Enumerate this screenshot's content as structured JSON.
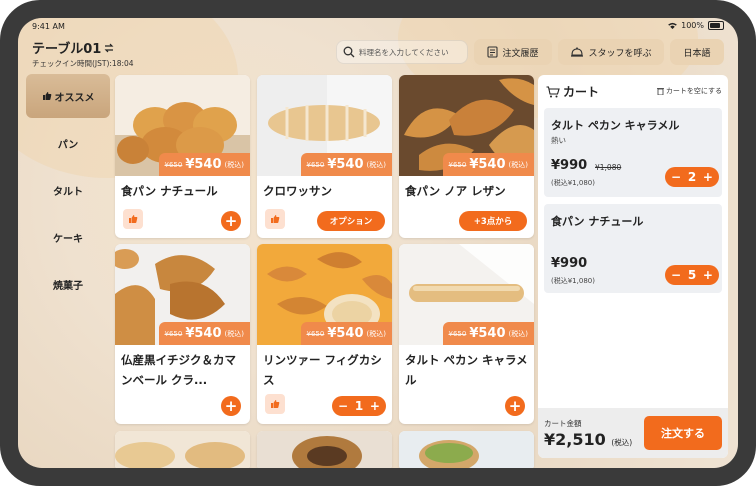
{
  "status": {
    "time": "9:41 AM",
    "battery": "100%"
  },
  "header": {
    "table_name": "テーブル01",
    "checkin": "チェックイン時間(JST):18:04",
    "search_placeholder": "料理名を入力してください",
    "order_history": "注文履歴",
    "call_staff": "スタッフを呼ぶ",
    "language": "日本語"
  },
  "sidebar": {
    "items": [
      {
        "label": "オススメ"
      },
      {
        "label": "パン"
      },
      {
        "label": "タルト"
      },
      {
        "label": "ケーキ"
      },
      {
        "label": "焼菓子"
      }
    ]
  },
  "products": [
    {
      "name": "食パン ナチュール",
      "old_price": "¥650",
      "price": "¥540",
      "tax": "(税込)",
      "action": "+"
    },
    {
      "name": "クロワッサン",
      "old_price": "¥650",
      "price": "¥540",
      "tax": "(税込)",
      "action": "オプション"
    },
    {
      "name": "食パン ノア レザン",
      "old_price": "¥650",
      "price": "¥540",
      "tax": "(税込)",
      "action": "+3点から"
    },
    {
      "name": "仏産黒イチジク＆カマンベール クラ...",
      "old_price": "¥650",
      "price": "¥540",
      "tax": "(税込)",
      "action": "+"
    },
    {
      "name": "リンツァー フィグカシス",
      "old_price": "¥650",
      "price": "¥540",
      "tax": "(税込)",
      "quantity": "1"
    },
    {
      "name": "タルト ペカン キャラメル",
      "old_price": "¥650",
      "price": "¥540",
      "tax": "(税込)",
      "action": "+"
    }
  ],
  "cart": {
    "title": "カート",
    "clear": "カートを空にする",
    "items": [
      {
        "name": "タルト ペカン キャラメル",
        "option": "熱い",
        "price": "¥990",
        "old_price": "¥1,080",
        "tax_price": "(税込¥1,080)",
        "quantity": "2"
      },
      {
        "name": "食パン ナチュール",
        "price": "¥990",
        "tax_price": "(税込¥1,080)",
        "quantity": "5"
      }
    ],
    "total_label": "カート金額",
    "total": "¥2,510",
    "total_tax": "(税込)",
    "order_button": "注文する"
  },
  "colors": {
    "accent": "#f26b1d",
    "price_tag": "#f08a4b",
    "header_button": "#ead3b3"
  }
}
